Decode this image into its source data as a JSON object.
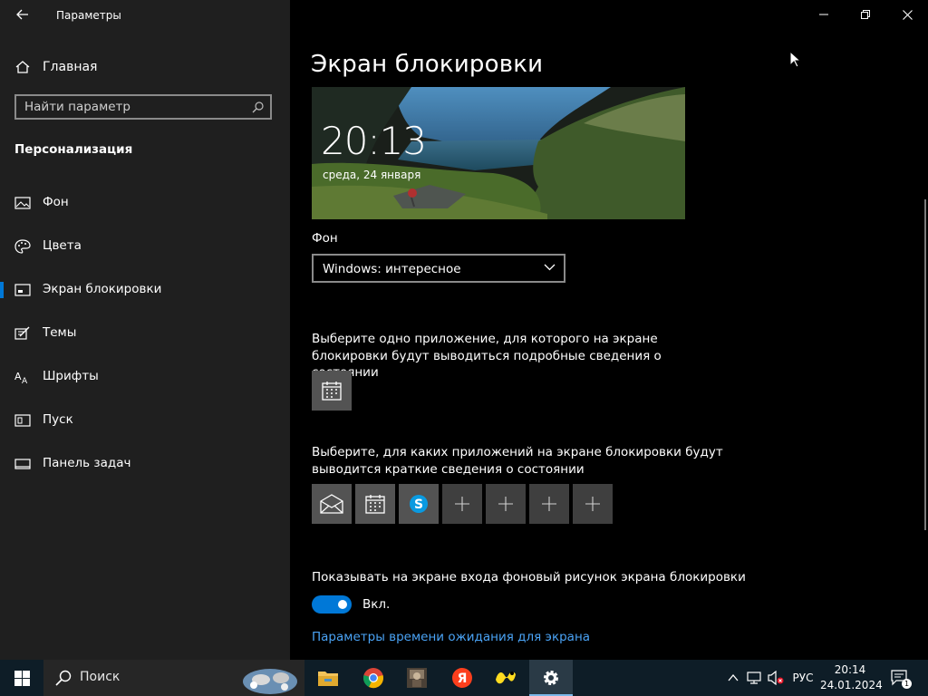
{
  "window": {
    "title": "Параметры"
  },
  "sidebar": {
    "home_label": "Главная",
    "search_placeholder": "Найти параметр",
    "section_title": "Персонализация",
    "items": [
      {
        "label": "Фон",
        "icon": "image-icon",
        "selected": false
      },
      {
        "label": "Цвета",
        "icon": "palette-icon",
        "selected": false
      },
      {
        "label": "Экран блокировки",
        "icon": "lock-screen-icon",
        "selected": true
      },
      {
        "label": "Темы",
        "icon": "themes-icon",
        "selected": false
      },
      {
        "label": "Шрифты",
        "icon": "fonts-icon",
        "selected": false
      },
      {
        "label": "Пуск",
        "icon": "start-icon",
        "selected": false
      },
      {
        "label": "Панель задач",
        "icon": "taskbar-icon",
        "selected": false
      }
    ]
  },
  "main": {
    "title": "Экран блокировки",
    "preview": {
      "time": "20:13",
      "date": "среда, 24 января"
    },
    "background_label": "Фон",
    "background_value": "Windows: интересное",
    "detailed_status_desc": "Выберите одно приложение, для которого на экране блокировки будут выводиться подробные сведения о состоянии",
    "detailed_status_app": "calendar-icon",
    "quick_status_desc": "Выберите, для каких приложений на экране блокировки будут выводится краткие сведения о состоянии",
    "quick_status_apps": [
      "mail-icon",
      "calendar-icon",
      "skype-icon",
      "plus-icon",
      "plus-icon",
      "plus-icon",
      "plus-icon"
    ],
    "signin_bg_label": "Показывать на экране входа фоновый рисунок экрана блокировки",
    "toggle_state": "Вкл.",
    "toggle_on": true,
    "timeout_link": "Параметры времени ожидания для экрана"
  },
  "taskbar": {
    "search_label": "Поиск",
    "apps": [
      "file-explorer-icon",
      "chrome-icon",
      "game-app-icon",
      "yandex-browser-icon",
      "yandex-market-icon",
      "settings-icon"
    ],
    "active_app": "settings-icon",
    "language": "РУС",
    "time": "20:14",
    "date": "24.01.2024",
    "notification_count": "1"
  },
  "colors": {
    "accent": "#0078d7",
    "link": "#4aa3f5",
    "sidebar_bg": "#1f1f1f",
    "content_bg": "#000000",
    "taskbar_bg": "#0e1d27"
  }
}
